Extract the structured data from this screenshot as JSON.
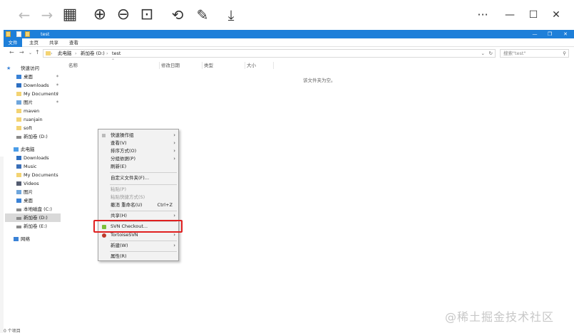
{
  "viewer": {
    "back_icon": "←",
    "forward_icon": "→",
    "grid_icon": "▦",
    "zoom_in_icon": "⊕",
    "zoom_out_icon": "⊖",
    "fit_icon": "⊡",
    "rotate_icon": "⟲",
    "edit_icon": "✎",
    "download_icon": "⤓",
    "more_icon": "···",
    "minimize_icon": "—",
    "maximize_icon": "☐",
    "close_icon": "✕"
  },
  "window": {
    "title": "test",
    "ribbon_tabs": [
      "文件",
      "主页",
      "共享",
      "查看"
    ],
    "min": "—",
    "max": "❐",
    "close": "✕"
  },
  "address": {
    "segments": [
      "此电脑",
      "新加卷 (D:)",
      "test"
    ],
    "separator": "›",
    "search_placeholder": "搜索\"test\"",
    "search_icon": "⚲"
  },
  "nav": {
    "items": [
      {
        "label": "快速访问",
        "icon": "star"
      },
      {
        "label": "桌面",
        "icon": "blue",
        "pin": true
      },
      {
        "label": "Downloads",
        "icon": "dl",
        "pin": true
      },
      {
        "label": "My Documents",
        "icon": "folder",
        "pin": true
      },
      {
        "label": "图片",
        "icon": "pic",
        "pin": true
      },
      {
        "label": "maven",
        "icon": "folder"
      },
      {
        "label": "ruanjain",
        "icon": "folder"
      },
      {
        "label": "soft",
        "icon": "folder"
      },
      {
        "label": "新加卷 (D:)",
        "icon": "drive"
      },
      {
        "label": "此电脑",
        "icon": "pc"
      },
      {
        "label": "Downloads",
        "icon": "dl"
      },
      {
        "label": "Music",
        "icon": "music"
      },
      {
        "label": "My Documents",
        "icon": "folder"
      },
      {
        "label": "Videos",
        "icon": "vid"
      },
      {
        "label": "图片",
        "icon": "pic"
      },
      {
        "label": "桌面",
        "icon": "blue"
      },
      {
        "label": "本地磁盘 (C:)",
        "icon": "drive"
      },
      {
        "label": "新加卷 (D:)",
        "icon": "drive",
        "selected": true
      },
      {
        "label": "新加卷 (E:)",
        "icon": "drive"
      },
      {
        "label": "网络",
        "icon": "net"
      }
    ]
  },
  "columns": [
    "名称",
    "修改日期",
    "类型",
    "大小"
  ],
  "empty_message": "该文件夹为空。",
  "status": "0 个项目",
  "menu": {
    "items": [
      {
        "label": "快速操作组",
        "arrow": true
      },
      {
        "label": "查看(V)",
        "arrow": true
      },
      {
        "label": "排序方式(O)",
        "arrow": true
      },
      {
        "label": "分组依据(P)",
        "arrow": true
      },
      {
        "label": "刷新(E)"
      },
      {
        "label": "自定义文件夹(F)..."
      },
      {
        "label": "粘贴(P)",
        "disabled": true
      },
      {
        "label": "粘贴快捷方式(S)",
        "disabled": true
      },
      {
        "label": "撤消 重命名(U)",
        "shortcut": "Ctrl+Z"
      },
      {
        "label": "共享(H)",
        "arrow": true
      },
      {
        "label": "SVN Checkout..."
      },
      {
        "label": "TortoiseSVN",
        "arrow": true
      },
      {
        "label": "新建(W)",
        "arrow": true
      },
      {
        "label": "属性(R)"
      }
    ],
    "arrow_glyph": "›"
  },
  "watermark": "@稀土掘金技术社区",
  "colors": {
    "accent": "#1e7fd9",
    "highlight": "#e02020"
  }
}
